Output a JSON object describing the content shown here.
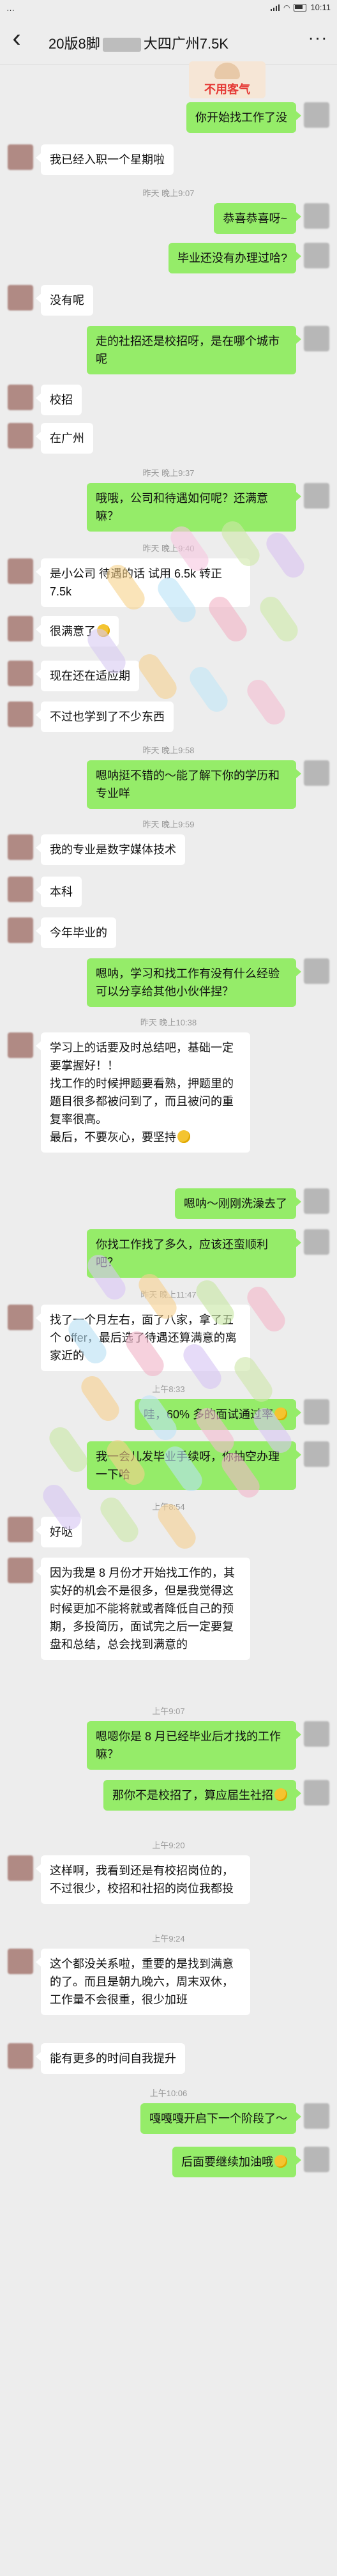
{
  "status_bar": {
    "left": "…",
    "time": "10:11",
    "icons": [
      "signal-icon",
      "wifi-icon",
      "battery-icon"
    ]
  },
  "header": {
    "title_prefix": "20版8脚",
    "title_suffix": "大四广州7.5K",
    "back_icon": "chevron-left-icon",
    "more_icon": "more-icon",
    "more_glyph": "···",
    "back_glyph": "‹"
  },
  "sticker_text": "不用客气",
  "messages": [
    {
      "side": "right",
      "text": "你开始找工作了没"
    },
    {
      "side": "left",
      "text": "我已经入职一个星期啦"
    },
    {
      "side": "time",
      "text": "昨天 晚上9:07"
    },
    {
      "side": "right",
      "text": "恭喜恭喜呀~"
    },
    {
      "side": "right",
      "text": "毕业还没有办理过哈?"
    },
    {
      "side": "left",
      "text": "没有呢"
    },
    {
      "side": "right",
      "text": "走的社招还是校招呀，是在哪个城市呢"
    },
    {
      "side": "left",
      "text": "校招"
    },
    {
      "side": "left",
      "text": "在广州"
    },
    {
      "side": "time",
      "text": "昨天 晚上9:37"
    },
    {
      "side": "right",
      "text": "哦哦，公司和待遇如何呢？还满意嘛？"
    },
    {
      "side": "time",
      "text": "昨天 晚上9:40"
    },
    {
      "side": "left",
      "text": "是小公司 待遇的话 试用 6.5k 转正 7.5k"
    },
    {
      "side": "left",
      "text": "很满意了"
    },
    {
      "side": "left",
      "text": "现在还在适应期"
    },
    {
      "side": "left",
      "text": "不过也学到了不少东西"
    },
    {
      "side": "time",
      "text": "昨天 晚上9:58"
    },
    {
      "side": "right",
      "text": "嗯呐挺不错的～能了解下你的学历和专业咩"
    },
    {
      "side": "time",
      "text": "昨天 晚上9:59"
    },
    {
      "side": "left",
      "text": "我的专业是数字媒体技术"
    },
    {
      "side": "left",
      "text": "本科"
    },
    {
      "side": "left",
      "text": "今年毕业的"
    },
    {
      "side": "right",
      "text": "嗯呐，学习和找工作有没有什么经验可以分享给其他小伙伴捏？"
    },
    {
      "side": "time",
      "text": "昨天 晚上10:38"
    },
    {
      "side": "left",
      "text": "学习上的话要及时总结吧，基础一定要掌握好！！\n找工作的时候押题要看熟，押题里的题目很多都被问到了，而且被问的重复率很高。\n最后，不要灰心，要坚持"
    },
    {
      "side": "right",
      "text": "嗯呐～刚刚洗澡去了"
    },
    {
      "side": "right",
      "text": "你找工作找了多久，应该还蛮顺利吧？"
    },
    {
      "side": "time",
      "text": "昨天 晚上11:47"
    },
    {
      "side": "left",
      "text": "找了一个月左右，面了八家，拿了五个 offer，最后选了待遇还算满意的离家近的"
    },
    {
      "side": "time",
      "text": "上午8:33"
    },
    {
      "side": "right",
      "text": "哇，60% 多的面试通过率"
    },
    {
      "side": "right",
      "text": "我一会儿发毕业手续呀，你抽空办理一下哈"
    },
    {
      "side": "time",
      "text": "上午8:54"
    },
    {
      "side": "left",
      "text": "好哒"
    },
    {
      "side": "left",
      "text": "因为我是 8 月份才开始找工作的，其实好的机会不是很多，但是我觉得这时候更加不能将就或者降低自己的预期，多投简历，面试完之后一定要复盘和总结，总会找到满意的"
    },
    {
      "side": "time",
      "text": "上午9:07"
    },
    {
      "side": "right",
      "text": "嗯嗯你是 8 月已经毕业后才找的工作嘛？"
    },
    {
      "side": "right",
      "text": "那你不是校招了，算应届生社招"
    },
    {
      "side": "time",
      "text": "上午9:20"
    },
    {
      "side": "left",
      "text": "这样啊，我看到还是有校招岗位的，不过很少，校招和社招的岗位我都投"
    },
    {
      "side": "time",
      "text": "上午9:24"
    },
    {
      "side": "left",
      "text": "这个都没关系啦，重要的是找到满意的了。而且是朝九晚六，周末双休，工作量不会很重，很少加班"
    },
    {
      "side": "left",
      "text": "能有更多的时间自我提升"
    },
    {
      "side": "time",
      "text": "上午10:06"
    },
    {
      "side": "right",
      "text": "嘎嘎嘎开启下一个阶段了～"
    },
    {
      "side": "right",
      "text": "后面要继续加油哦"
    }
  ],
  "colors": {
    "background": "#ededed",
    "bubble_mine": "#95ec69",
    "bubble_theirs": "#ffffff",
    "timestamp": "#999999"
  }
}
